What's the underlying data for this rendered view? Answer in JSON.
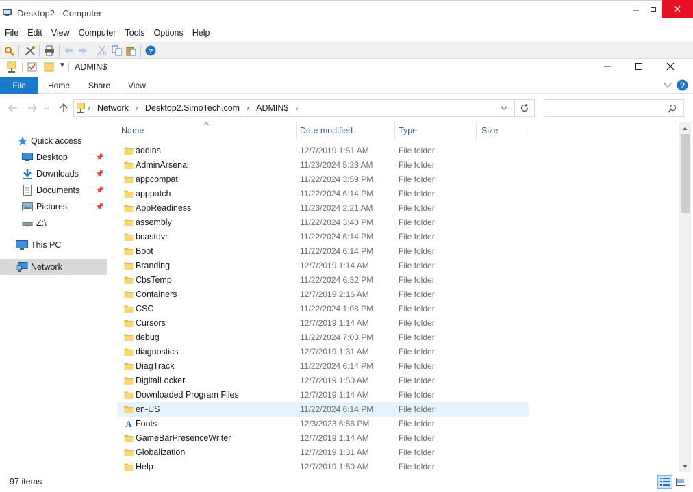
{
  "outer_window": {
    "title": "Desktop2 - Computer",
    "menu": [
      "File",
      "Edit",
      "View",
      "Computer",
      "Tools",
      "Options",
      "Help"
    ],
    "toolbar_icons": [
      "search-icon",
      "tools-icon",
      "print-icon",
      "back-arrow-icon",
      "forward-arrow-icon",
      "cut-icon",
      "copy-icon",
      "paste-icon",
      "help-icon"
    ]
  },
  "explorer": {
    "title": "ADMIN$",
    "ribbon_tabs": [
      "File",
      "Home",
      "Share",
      "View"
    ],
    "address": {
      "crumbs": [
        "Network",
        "Desktop2.SimoTech.com",
        "ADMIN$"
      ],
      "search_placeholder": ""
    },
    "nav_pane": [
      {
        "label": "Quick access",
        "icon": "star-icon",
        "pinned": false
      },
      {
        "label": "Desktop",
        "icon": "desktop-icon",
        "pinned": true
      },
      {
        "label": "Downloads",
        "icon": "download-icon",
        "pinned": true
      },
      {
        "label": "Documents",
        "icon": "documents-icon",
        "pinned": true
      },
      {
        "label": "Pictures",
        "icon": "pictures-icon",
        "pinned": true
      },
      {
        "label": "Z:\\",
        "icon": "network-drive-icon",
        "pinned": false
      },
      {
        "label": "This PC",
        "icon": "computer-icon",
        "pinned": false
      },
      {
        "label": "Network",
        "icon": "network-icon",
        "pinned": false,
        "selected": true
      }
    ],
    "columns": [
      "Name",
      "Date modified",
      "Type",
      "Size"
    ],
    "files": [
      {
        "name": "addins",
        "date": "12/7/2019 1:51 AM",
        "type": "File folder"
      },
      {
        "name": "AdminArsenal",
        "date": "11/23/2024 5:23 AM",
        "type": "File folder"
      },
      {
        "name": "appcompat",
        "date": "11/22/2024 3:59 PM",
        "type": "File folder"
      },
      {
        "name": "apppatch",
        "date": "11/22/2024 6:14 PM",
        "type": "File folder"
      },
      {
        "name": "AppReadiness",
        "date": "11/23/2024 2:21 AM",
        "type": "File folder"
      },
      {
        "name": "assembly",
        "date": "11/22/2024 3:40 PM",
        "type": "File folder"
      },
      {
        "name": "bcastdvr",
        "date": "11/22/2024 6:14 PM",
        "type": "File folder"
      },
      {
        "name": "Boot",
        "date": "11/22/2024 6:14 PM",
        "type": "File folder"
      },
      {
        "name": "Branding",
        "date": "12/7/2019 1:14 AM",
        "type": "File folder"
      },
      {
        "name": "CbsTemp",
        "date": "11/22/2024 6:32 PM",
        "type": "File folder"
      },
      {
        "name": "Containers",
        "date": "12/7/2019 2:16 AM",
        "type": "File folder"
      },
      {
        "name": "CSC",
        "date": "11/22/2024 1:08 PM",
        "type": "File folder"
      },
      {
        "name": "Cursors",
        "date": "12/7/2019 1:14 AM",
        "type": "File folder"
      },
      {
        "name": "debug",
        "date": "11/22/2024 7:03 PM",
        "type": "File folder"
      },
      {
        "name": "diagnostics",
        "date": "12/7/2019 1:31 AM",
        "type": "File folder"
      },
      {
        "name": "DiagTrack",
        "date": "11/22/2024 6:14 PM",
        "type": "File folder"
      },
      {
        "name": "DigitalLocker",
        "date": "12/7/2019 1:50 AM",
        "type": "File folder"
      },
      {
        "name": "Downloaded Program Files",
        "date": "12/7/2019 1:14 AM",
        "type": "File folder"
      },
      {
        "name": "en-US",
        "date": "11/22/2024 6:14 PM",
        "type": "File folder",
        "highlighted": true
      },
      {
        "name": "Fonts",
        "date": "12/3/2023 6:56 PM",
        "type": "File folder",
        "icon": "fonts-folder-icon"
      },
      {
        "name": "GameBarPresenceWriter",
        "date": "12/7/2019 1:14 AM",
        "type": "File folder"
      },
      {
        "name": "Globalization",
        "date": "12/7/2019 1:31 AM",
        "type": "File folder"
      },
      {
        "name": "Help",
        "date": "12/7/2019 1:50 AM",
        "type": "File folder"
      }
    ],
    "status": {
      "item_count": "97 items"
    }
  },
  "colors": {
    "accent": "#1979ca",
    "folder": "#f8d775",
    "close": "#e81123",
    "row_highlight": "#e5f3ff",
    "header_text": "#4c607a"
  }
}
